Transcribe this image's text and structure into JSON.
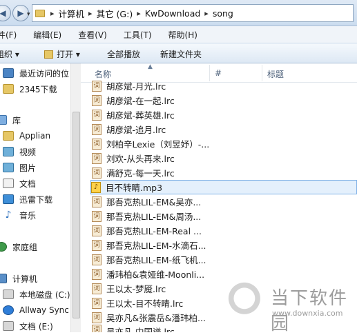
{
  "address": {
    "crumbs": [
      "计算机",
      "其它 (G:)",
      "KwDownload",
      "song"
    ],
    "separator": "▸"
  },
  "menu": [
    "件(F)",
    "编辑(E)",
    "查看(V)",
    "工具(T)",
    "帮助(H)"
  ],
  "toolbar": {
    "organize": "组织 ▾",
    "open": "打开 ▾",
    "play_all": "全部播放",
    "new_folder": "新建文件夹"
  },
  "columns": {
    "name": "名称",
    "number": "#",
    "title": "标题"
  },
  "sidebar": [
    {
      "label": "最近访问的位",
      "icon": "recent-places-icon"
    },
    {
      "label": "2345下载",
      "icon": "folder-icon"
    },
    {
      "label": "库",
      "icon": "library-icon"
    },
    {
      "label": "Applian",
      "icon": "folder-icon"
    },
    {
      "label": "视频",
      "icon": "video-icon"
    },
    {
      "label": "图片",
      "icon": "pictures-icon"
    },
    {
      "label": "文档",
      "icon": "documents-icon"
    },
    {
      "label": "迅雷下载",
      "icon": "thunder-icon"
    },
    {
      "label": "音乐",
      "icon": "music-icon"
    },
    {
      "label": "家庭组",
      "icon": "homegroup-icon"
    },
    {
      "label": "计算机",
      "icon": "computer-icon"
    },
    {
      "label": "本地磁盘 (C:)",
      "icon": "drive-icon"
    },
    {
      "label": "Allway Sync",
      "icon": "sync-icon"
    },
    {
      "label": "文档 (E:)",
      "icon": "drive-icon"
    }
  ],
  "files": [
    {
      "name": "胡彦斌-月光.lrc",
      "type": "lrc"
    },
    {
      "name": "胡彦斌-在一起.lrc",
      "type": "lrc"
    },
    {
      "name": "胡彦斌-葬英雄.lrc",
      "type": "lrc"
    },
    {
      "name": "胡彦斌-追月.lrc",
      "type": "lrc"
    },
    {
      "name": "刘柏辛Lexie（刘昱妤）-...",
      "type": "lrc"
    },
    {
      "name": "刘欢-从头再来.lrc",
      "type": "lrc"
    },
    {
      "name": "满舒克-每一天.lrc",
      "type": "lrc"
    },
    {
      "name": "目不转睛.mp3",
      "type": "mp3",
      "selected": true
    },
    {
      "name": "那吾克热LIL-EM&吴亦...",
      "type": "lrc"
    },
    {
      "name": "那吾克热LIL-EM&周汤...",
      "type": "lrc"
    },
    {
      "name": "那吾克热LIL-EM-Real ...",
      "type": "lrc"
    },
    {
      "name": "那吾克热LIL-EM-水滴石...",
      "type": "lrc"
    },
    {
      "name": "那吾克热LIL-EM-纸飞机...",
      "type": "lrc"
    },
    {
      "name": "潘玮柏&袁娅维-Moonli...",
      "type": "lrc"
    },
    {
      "name": "王以太-梦魇.lrc",
      "type": "lrc"
    },
    {
      "name": "王以太-目不转睛.lrc",
      "type": "lrc"
    },
    {
      "name": "吴亦凡&张震岳&潘玮柏...",
      "type": "lrc"
    },
    {
      "name": "吴亦凡-中国谱.lrc",
      "type": "lrc"
    }
  ],
  "file_icon_label": "词",
  "music_glyph": "♪",
  "watermark": {
    "text": "当下软件园",
    "url": "www.downxia.com"
  }
}
